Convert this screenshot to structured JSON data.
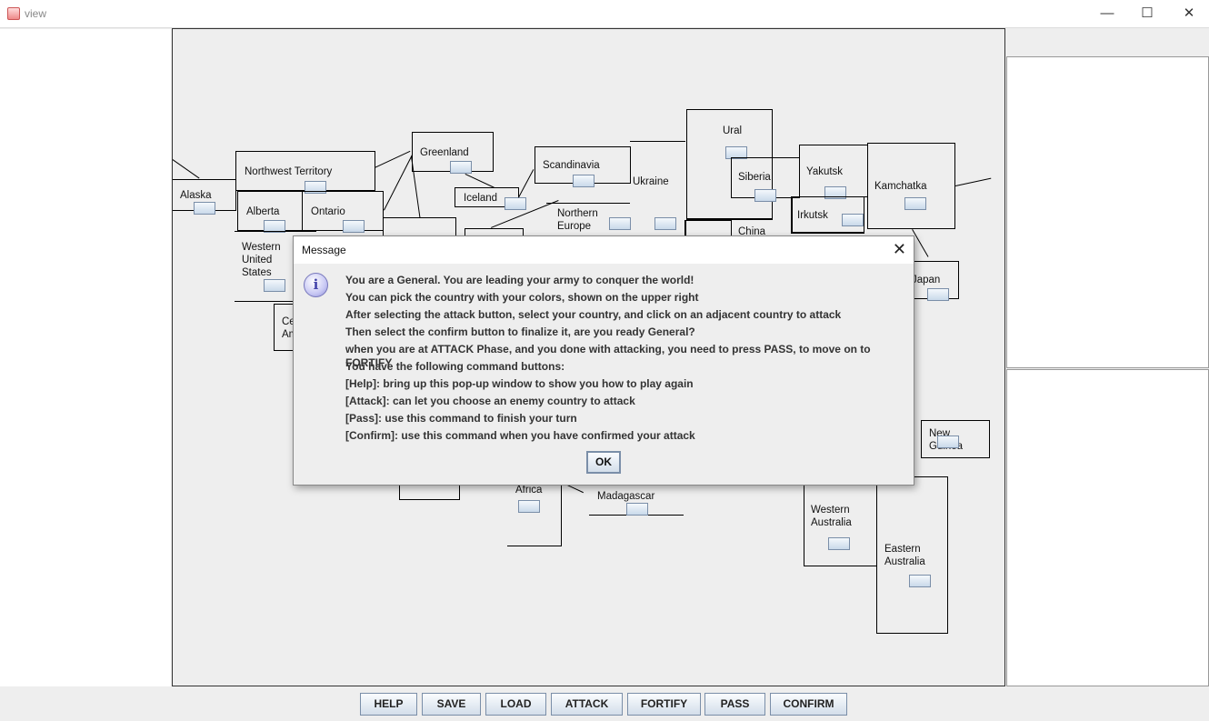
{
  "window": {
    "title": "view",
    "minimize": "—",
    "maximize": "☐",
    "close": "✕"
  },
  "territories": {
    "alaska": "Alaska",
    "northwest_territory": "Northwest Territory",
    "alberta": "Alberta",
    "ontario": "Ontario",
    "western_united_states": "Western\nUnited\nStates",
    "central_america": "Ce\nAm",
    "greenland": "Greenland",
    "iceland": "Iceland",
    "scandinavia": "Scandinavia",
    "ukraine": "Ukraine",
    "northern_europe": "Northern\nEurope",
    "ural": "Ural",
    "siberia": "Siberia",
    "yakutsk": "Yakutsk",
    "irkutsk": "Irkutsk",
    "kamchatka": "Kamchatka",
    "china": "China",
    "japan": "Japan",
    "new_guinea": "New\nGuinea",
    "western_australia": "Western\nAustralia",
    "eastern_australia": "Eastern\nAustralia",
    "africa": "Africa",
    "madagascar": "Madagascar"
  },
  "commands": [
    "HELP",
    "SAVE",
    "LOAD",
    "ATTACK",
    "FORTIFY",
    "PASS",
    "CONFIRM"
  ],
  "dialog": {
    "title": "Message",
    "close": "✕",
    "icon": "information-icon",
    "icon_glyph": "i",
    "lines": [
      "You are a General. You are leading your army to conquer the world!",
      "You can pick the country with your colors, shown on the upper right",
      "After selecting the attack button, select your country, and click on an adjacent country to attack",
      "Then select the confirm button to finalize it, are you ready General?",
      "when you are at ATTACK Phase, and you done with attacking, you need to press PASS, to move on to FORTIFY",
      "You have the following command buttons:",
      "[Help]: bring up this pop-up window to show you how to play again",
      "[Attack]: can let you choose an enemy country to attack",
      "[Pass]: use this command to finish your turn",
      "[Confirm]: use this command when you have confirmed your attack"
    ],
    "ok": "OK"
  }
}
